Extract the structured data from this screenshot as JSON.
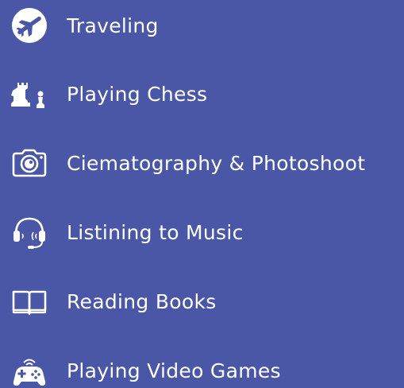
{
  "hobbies": [
    {
      "label": "Traveling",
      "icon": "airplane-icon"
    },
    {
      "label": "Playing Chess",
      "icon": "chess-icon"
    },
    {
      "label": "Ciematography & Photoshoot",
      "icon": "camera-icon"
    },
    {
      "label": "Listining to Music",
      "icon": "headphones-icon"
    },
    {
      "label": "Reading Books",
      "icon": "book-icon"
    },
    {
      "label": "Playing Video Games",
      "icon": "gamepad-icon"
    }
  ],
  "colors": {
    "background": "#4a56a6",
    "foreground": "#ffffff"
  }
}
